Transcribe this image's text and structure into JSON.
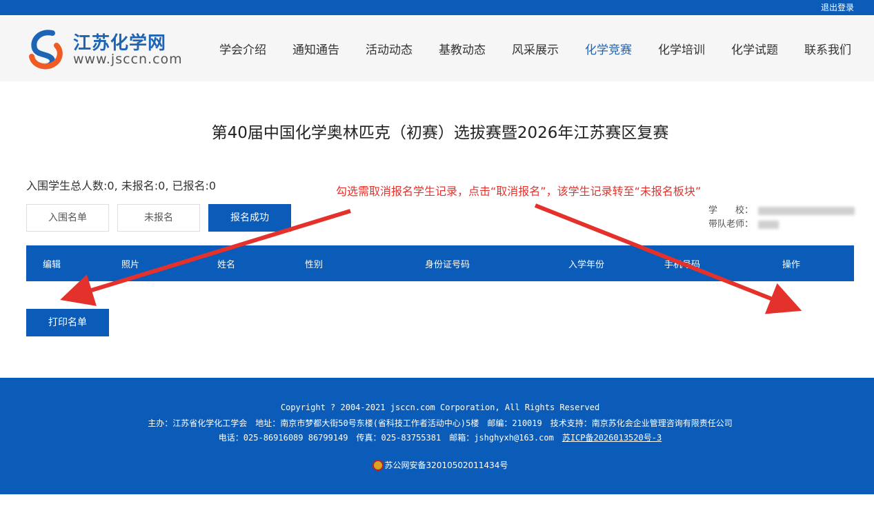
{
  "topbar": {
    "logout_label": "退出登录"
  },
  "logo": {
    "title": "江苏化学网",
    "url": "www.jsccn.com"
  },
  "nav": [
    {
      "label": "学会介绍"
    },
    {
      "label": "通知通告"
    },
    {
      "label": "活动动态"
    },
    {
      "label": "基教动态"
    },
    {
      "label": "风采展示"
    },
    {
      "label": "化学竞赛",
      "active": true
    },
    {
      "label": "化学培训"
    },
    {
      "label": "化学试题"
    },
    {
      "label": "联系我们"
    }
  ],
  "page_title": "第40届中国化学奥林匹克（初赛）选拔赛暨2026年江苏赛区复赛",
  "stats": "入围学生总人数:0, 未报名:0, 已报名:0",
  "annotation": "勾选需取消报名学生记录，点击“取消报名”，该学生记录转至“未报名板块”",
  "tabs": [
    {
      "label": "入围名单"
    },
    {
      "label": "未报名"
    },
    {
      "label": "报名成功",
      "active": true
    }
  ],
  "school_info": {
    "school_label": "学　　校：",
    "teacher_label": "带队老师："
  },
  "table": {
    "headers": [
      "编辑",
      "照片",
      "姓名",
      "性别",
      "身份证号码",
      "入学年份",
      "手机号码",
      "操作"
    ]
  },
  "print_button": "打印名单",
  "footer": {
    "copyright": "Copyright ? 2004-2021 jsccn.com Corporation, All Rights Reserved",
    "line2": "主办：江苏省化学化工学会　地址：南京市梦都大街50号东楼(省科技工作者活动中心)5楼　邮编：210019　技术支持：南京苏化会企业管理咨询有限责任公司",
    "line3_prefix": "电话：025-86916089 86799149　传真：025-83755381　邮箱：jshghyxh@163.com　",
    "icp": "苏ICP备2026013520号-3",
    "police": "苏公网安备32010502011434号"
  },
  "colors": {
    "brand": "#0a5cb8",
    "annotation": "#e5312b"
  }
}
